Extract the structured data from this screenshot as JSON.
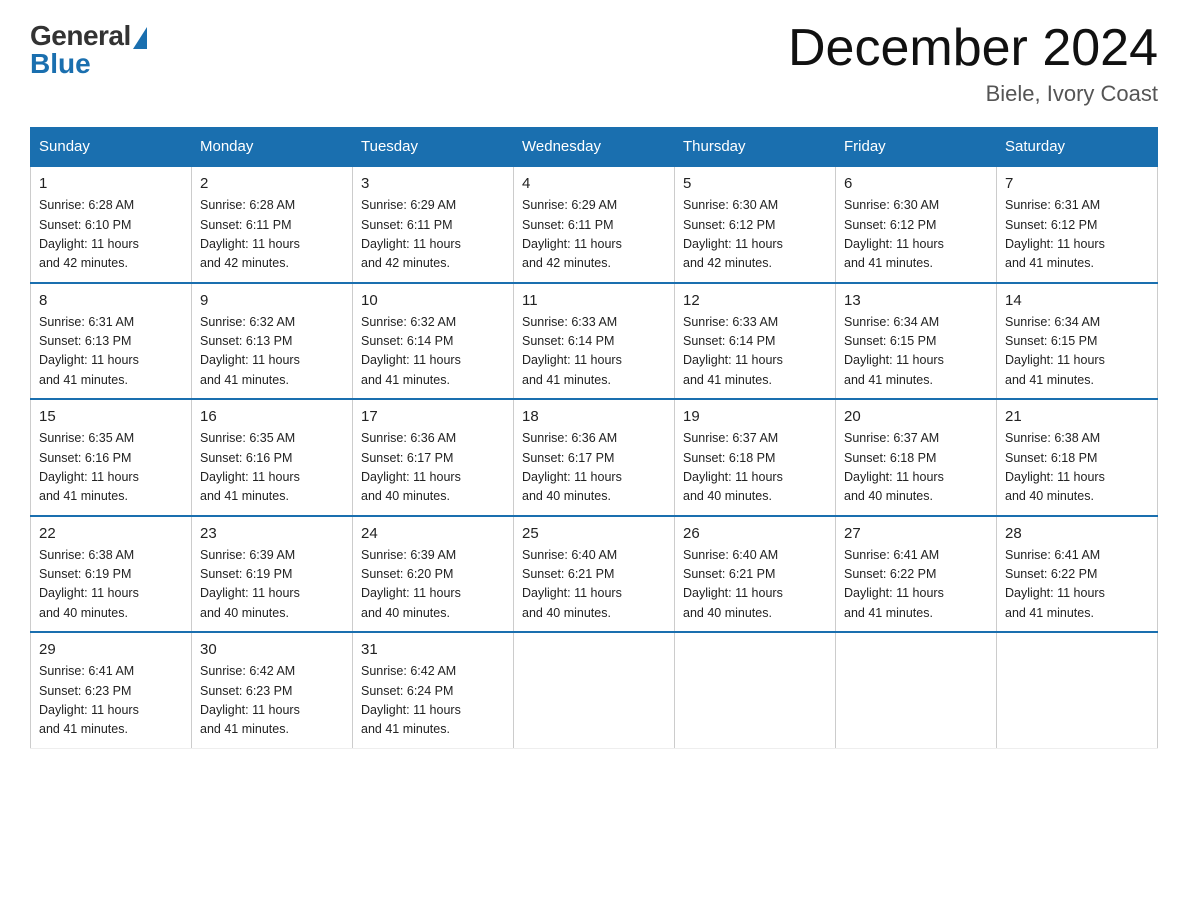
{
  "logo": {
    "general": "General",
    "blue": "Blue"
  },
  "title": {
    "month": "December 2024",
    "location": "Biele, Ivory Coast"
  },
  "headers": [
    "Sunday",
    "Monday",
    "Tuesday",
    "Wednesday",
    "Thursday",
    "Friday",
    "Saturday"
  ],
  "weeks": [
    [
      {
        "day": "1",
        "info": "Sunrise: 6:28 AM\nSunset: 6:10 PM\nDaylight: 11 hours\nand 42 minutes."
      },
      {
        "day": "2",
        "info": "Sunrise: 6:28 AM\nSunset: 6:11 PM\nDaylight: 11 hours\nand 42 minutes."
      },
      {
        "day": "3",
        "info": "Sunrise: 6:29 AM\nSunset: 6:11 PM\nDaylight: 11 hours\nand 42 minutes."
      },
      {
        "day": "4",
        "info": "Sunrise: 6:29 AM\nSunset: 6:11 PM\nDaylight: 11 hours\nand 42 minutes."
      },
      {
        "day": "5",
        "info": "Sunrise: 6:30 AM\nSunset: 6:12 PM\nDaylight: 11 hours\nand 42 minutes."
      },
      {
        "day": "6",
        "info": "Sunrise: 6:30 AM\nSunset: 6:12 PM\nDaylight: 11 hours\nand 41 minutes."
      },
      {
        "day": "7",
        "info": "Sunrise: 6:31 AM\nSunset: 6:12 PM\nDaylight: 11 hours\nand 41 minutes."
      }
    ],
    [
      {
        "day": "8",
        "info": "Sunrise: 6:31 AM\nSunset: 6:13 PM\nDaylight: 11 hours\nand 41 minutes."
      },
      {
        "day": "9",
        "info": "Sunrise: 6:32 AM\nSunset: 6:13 PM\nDaylight: 11 hours\nand 41 minutes."
      },
      {
        "day": "10",
        "info": "Sunrise: 6:32 AM\nSunset: 6:14 PM\nDaylight: 11 hours\nand 41 minutes."
      },
      {
        "day": "11",
        "info": "Sunrise: 6:33 AM\nSunset: 6:14 PM\nDaylight: 11 hours\nand 41 minutes."
      },
      {
        "day": "12",
        "info": "Sunrise: 6:33 AM\nSunset: 6:14 PM\nDaylight: 11 hours\nand 41 minutes."
      },
      {
        "day": "13",
        "info": "Sunrise: 6:34 AM\nSunset: 6:15 PM\nDaylight: 11 hours\nand 41 minutes."
      },
      {
        "day": "14",
        "info": "Sunrise: 6:34 AM\nSunset: 6:15 PM\nDaylight: 11 hours\nand 41 minutes."
      }
    ],
    [
      {
        "day": "15",
        "info": "Sunrise: 6:35 AM\nSunset: 6:16 PM\nDaylight: 11 hours\nand 41 minutes."
      },
      {
        "day": "16",
        "info": "Sunrise: 6:35 AM\nSunset: 6:16 PM\nDaylight: 11 hours\nand 41 minutes."
      },
      {
        "day": "17",
        "info": "Sunrise: 6:36 AM\nSunset: 6:17 PM\nDaylight: 11 hours\nand 40 minutes."
      },
      {
        "day": "18",
        "info": "Sunrise: 6:36 AM\nSunset: 6:17 PM\nDaylight: 11 hours\nand 40 minutes."
      },
      {
        "day": "19",
        "info": "Sunrise: 6:37 AM\nSunset: 6:18 PM\nDaylight: 11 hours\nand 40 minutes."
      },
      {
        "day": "20",
        "info": "Sunrise: 6:37 AM\nSunset: 6:18 PM\nDaylight: 11 hours\nand 40 minutes."
      },
      {
        "day": "21",
        "info": "Sunrise: 6:38 AM\nSunset: 6:18 PM\nDaylight: 11 hours\nand 40 minutes."
      }
    ],
    [
      {
        "day": "22",
        "info": "Sunrise: 6:38 AM\nSunset: 6:19 PM\nDaylight: 11 hours\nand 40 minutes."
      },
      {
        "day": "23",
        "info": "Sunrise: 6:39 AM\nSunset: 6:19 PM\nDaylight: 11 hours\nand 40 minutes."
      },
      {
        "day": "24",
        "info": "Sunrise: 6:39 AM\nSunset: 6:20 PM\nDaylight: 11 hours\nand 40 minutes."
      },
      {
        "day": "25",
        "info": "Sunrise: 6:40 AM\nSunset: 6:21 PM\nDaylight: 11 hours\nand 40 minutes."
      },
      {
        "day": "26",
        "info": "Sunrise: 6:40 AM\nSunset: 6:21 PM\nDaylight: 11 hours\nand 40 minutes."
      },
      {
        "day": "27",
        "info": "Sunrise: 6:41 AM\nSunset: 6:22 PM\nDaylight: 11 hours\nand 41 minutes."
      },
      {
        "day": "28",
        "info": "Sunrise: 6:41 AM\nSunset: 6:22 PM\nDaylight: 11 hours\nand 41 minutes."
      }
    ],
    [
      {
        "day": "29",
        "info": "Sunrise: 6:41 AM\nSunset: 6:23 PM\nDaylight: 11 hours\nand 41 minutes."
      },
      {
        "day": "30",
        "info": "Sunrise: 6:42 AM\nSunset: 6:23 PM\nDaylight: 11 hours\nand 41 minutes."
      },
      {
        "day": "31",
        "info": "Sunrise: 6:42 AM\nSunset: 6:24 PM\nDaylight: 11 hours\nand 41 minutes."
      },
      null,
      null,
      null,
      null
    ]
  ]
}
